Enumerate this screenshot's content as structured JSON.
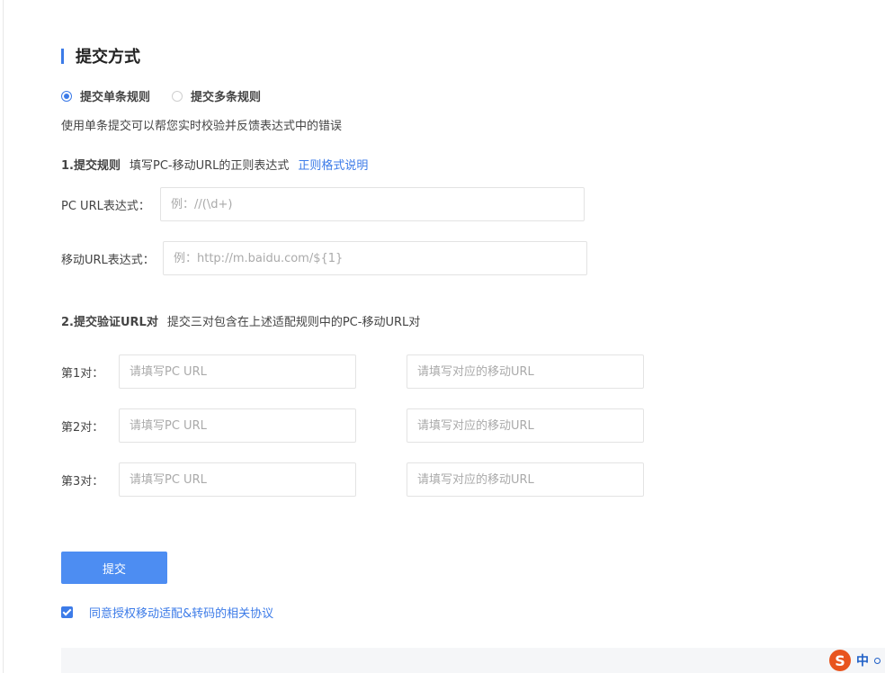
{
  "section": {
    "title": "提交方式"
  },
  "mode": {
    "options": [
      {
        "label": "提交单条规则",
        "selected": true
      },
      {
        "label": "提交多条规则",
        "selected": false
      }
    ]
  },
  "description": "使用单条提交可以帮您实时校验并反馈表达式中的错误",
  "step1": {
    "title": "1.提交规则",
    "text": "填写PC-移动URL的正则表达式",
    "link": "正则格式说明"
  },
  "pc_regex": {
    "label": "PC  URL表达式：",
    "placeholder": "例：//(\\d+)"
  },
  "mobile_regex": {
    "label": "移动URL表达式：",
    "placeholder": "例：http://m.baidu.com/${1}"
  },
  "step2": {
    "title": "2.提交验证URL对",
    "text": "提交三对包含在上述适配规则中的PC-移动URL对"
  },
  "pairs": [
    {
      "label": "第1对：",
      "pc_placeholder": "请填写PC URL",
      "mobile_placeholder": "请填写对应的移动URL"
    },
    {
      "label": "第2对：",
      "pc_placeholder": "请填写PC URL",
      "mobile_placeholder": "请填写对应的移动URL"
    },
    {
      "label": "第3对：",
      "pc_placeholder": "请填写PC URL",
      "mobile_placeholder": "请填写对应的移动URL"
    }
  ],
  "submit": {
    "label": "提交"
  },
  "agreement": {
    "checked": true,
    "text": "同意授权移动适配&转码的相关协议"
  },
  "ime": {
    "logo": "S",
    "mode": "中"
  },
  "colors": {
    "accent": "#3c7be8",
    "button": "#4d8df2"
  }
}
